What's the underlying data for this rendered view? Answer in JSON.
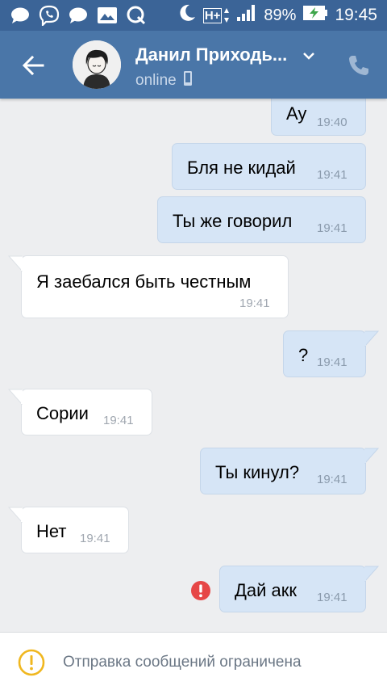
{
  "status_bar": {
    "network": "H+",
    "battery": "89%",
    "time": "19:45",
    "icons": [
      "chat-bubble-icon",
      "viber-icon",
      "chat-bubble-icon",
      "gallery-icon",
      "q-app-icon",
      "moon-icon",
      "network-h-plus-icon",
      "signal-icon",
      "battery-charging-icon"
    ]
  },
  "header": {
    "contact_name": "Данил Приходь...",
    "presence": "online",
    "icons": [
      "back-arrow-icon",
      "chevron-down-icon",
      "mobile-phone-icon",
      "phone-call-icon"
    ]
  },
  "messages": [
    {
      "dir": "out",
      "text": "Ау",
      "time": "19:40"
    },
    {
      "dir": "out",
      "text": "Бля не кидай",
      "time": "19:41"
    },
    {
      "dir": "out",
      "text": "Ты же говорил",
      "time": "19:41"
    },
    {
      "dir": "in",
      "text": "Я заебался быть честным",
      "time": "19:41"
    },
    {
      "dir": "out",
      "text": "?",
      "time": "19:41"
    },
    {
      "dir": "in",
      "text": "Сории",
      "time": "19:41"
    },
    {
      "dir": "out",
      "text": "Ты кинул?",
      "time": "19:41"
    },
    {
      "dir": "in",
      "text": "Нет",
      "time": "19:41"
    },
    {
      "dir": "out",
      "text": "Дай акк",
      "time": "19:41",
      "error": true
    }
  ],
  "footer": {
    "notice": "Отправка сообщений ограничена",
    "icon": "warning-circle-icon",
    "accent": "#f0b71f"
  },
  "colors": {
    "status_bar": "#3b6497",
    "header": "#4a76a8",
    "chat_bg": "#edeef0",
    "outgoing_bubble": "#d6e5f6",
    "incoming_bubble": "#ffffff",
    "error": "#e64646"
  }
}
